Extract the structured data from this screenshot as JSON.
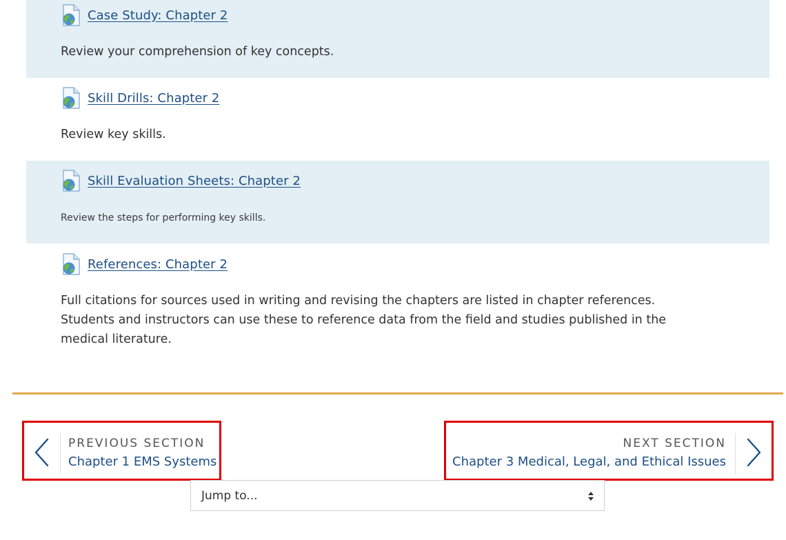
{
  "activities": [
    {
      "title": "Case Study: Chapter 2",
      "description": "Review your comprehension of key concepts.",
      "icon": "url-globe-icon"
    },
    {
      "title": "Skill Drills: Chapter 2",
      "description": "Review key skills.",
      "icon": "url-globe-icon"
    },
    {
      "title": "Skill Evaluation Sheets: Chapter 2",
      "description": "Review the steps for performing key skills.",
      "icon": "url-globe-icon"
    },
    {
      "title": "References: Chapter 2",
      "description": "Full citations for sources used in writing and revising the chapters are listed in chapter references. Students and instructors can use these to reference data from the field and studies published in the medical literature.",
      "icon": "url-globe-icon"
    }
  ],
  "navigation": {
    "previous": {
      "label": "PREVIOUS SECTION",
      "link": "Chapter 1 EMS Systems",
      "icon": "chevron-left-icon"
    },
    "next": {
      "label": "NEXT SECTION",
      "link": "Chapter 3 Medical, Legal, and Ethical Issues",
      "icon": "chevron-right-icon"
    }
  },
  "jump_to": {
    "selected": "Jump to...",
    "icon": "sort-caret-icon"
  },
  "colors": {
    "link": "#1d4f86",
    "shaded_row": "#e3eff5",
    "divider": "#e0a84a",
    "highlight_border": "#e00000"
  }
}
